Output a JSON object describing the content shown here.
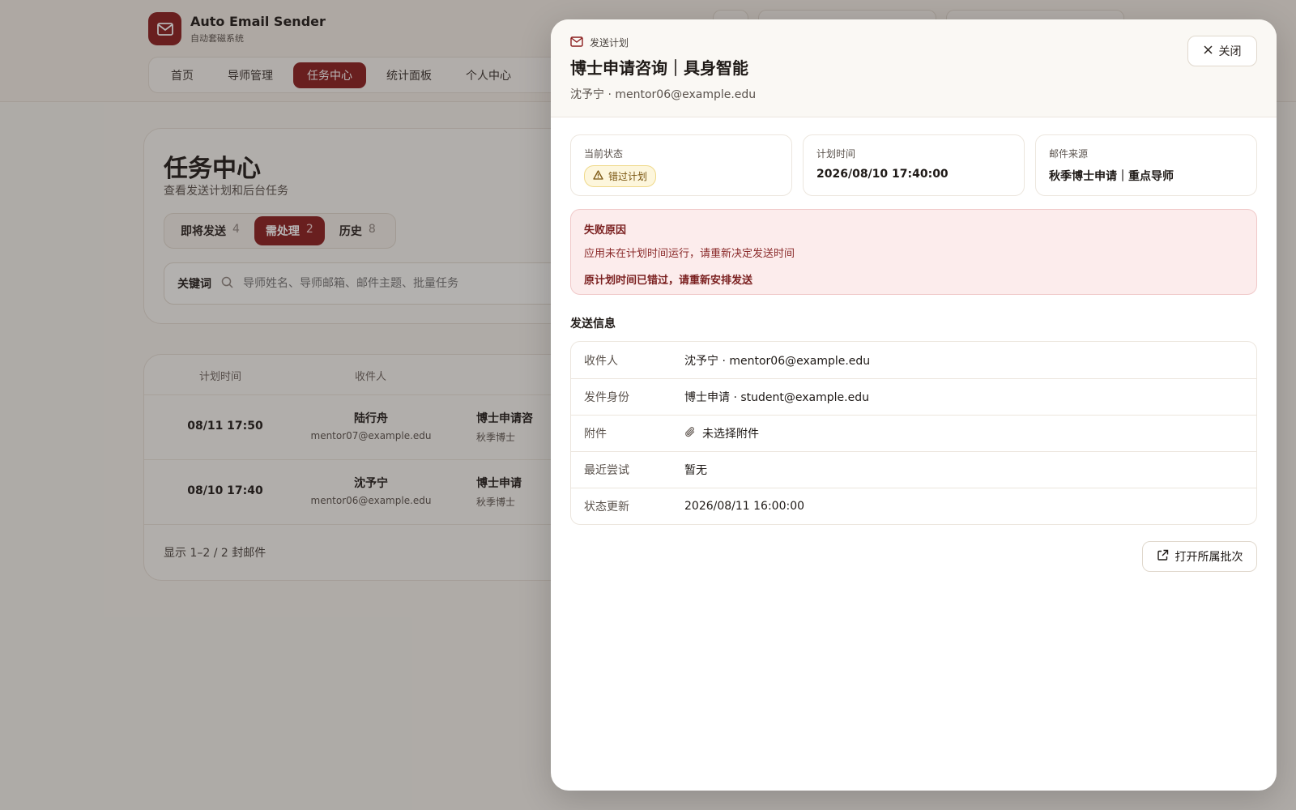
{
  "app": {
    "title": "Auto Email Sender",
    "subtitle": "自动套磁系统"
  },
  "nav": {
    "items": [
      {
        "label": "首页",
        "active": false
      },
      {
        "label": "导师管理",
        "active": false
      },
      {
        "label": "任务中心",
        "active": true
      },
      {
        "label": "统计面板",
        "active": false
      },
      {
        "label": "个人中心",
        "active": false
      }
    ]
  },
  "page": {
    "title": "任务中心",
    "subtitle": "查看发送计划和后台任务",
    "tabs": [
      {
        "label": "即将发送",
        "count": "4",
        "active": false
      },
      {
        "label": "需处理",
        "count": "2",
        "active": true
      },
      {
        "label": "历史",
        "count": "8",
        "active": false
      }
    ],
    "search": {
      "label": "关键词",
      "placeholder": "导师姓名、导师邮箱、邮件主题、批量任务"
    }
  },
  "table": {
    "headers": [
      "计划时间",
      "收件人"
    ],
    "rows": [
      {
        "time": "08/11 17:50",
        "name": "陆行舟",
        "email": "mentor07@example.edu",
        "subject": "博士申请咨",
        "batch": "秋季博士"
      },
      {
        "time": "08/10 17:40",
        "name": "沈予宁",
        "email": "mentor06@example.edu",
        "subject": "博士申请",
        "batch": "秋季博士"
      }
    ],
    "footer": "显示 1–2 / 2 封邮件"
  },
  "drawer": {
    "eyebrow": "发送计划",
    "title": "博士申请咨询｜具身智能",
    "subtitle": "沈予宁 · mentor06@example.edu",
    "close_label": "关闭",
    "cards": {
      "status_label": "当前状态",
      "status_value": "错过计划",
      "time_label": "计划时间",
      "time_value": "2026/08/10 17:40:00",
      "source_label": "邮件来源",
      "source_value": "秋季博士申请｜重点导师"
    },
    "failure": {
      "title": "失败原因",
      "reason": "应用未在计划时间运行，请重新决定发送时间",
      "note": "原计划时间已错过，请重新安排发送"
    },
    "section_title": "发送信息",
    "details": [
      {
        "key": "收件人",
        "value": "沈予宁 · mentor06@example.edu"
      },
      {
        "key": "发件身份",
        "value": "博士申请 · student@example.edu"
      },
      {
        "key": "附件",
        "value": "未选择附件"
      },
      {
        "key": "最近尝试",
        "value": "暂无"
      },
      {
        "key": "状态更新",
        "value": "2026/08/11 16:00:00"
      }
    ],
    "open_batch_label": "打开所属批次"
  },
  "colors": {
    "brand": "#8a1d1d",
    "warning_bg": "#fdf6dc",
    "error_bg": "#fcecec"
  }
}
